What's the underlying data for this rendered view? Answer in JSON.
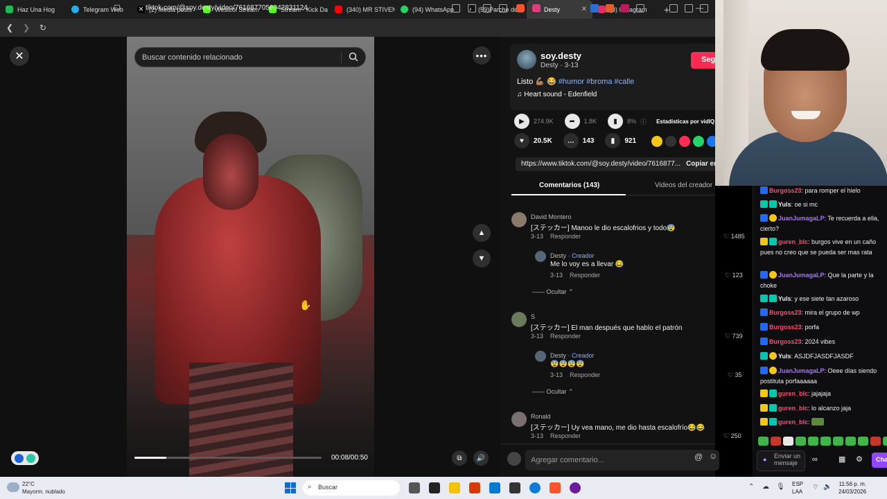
{
  "browser": {
    "tabs": [
      {
        "label": "Haz Una Hog",
        "color": "#1db954"
      },
      {
        "label": "Telegram Web",
        "color": "#2aabee"
      },
      {
        "label": "(2) Media posts",
        "color": "#000000"
      },
      {
        "label": "Westcol Stream",
        "color": "#53fc18"
      },
      {
        "label": "Stream - Kick Da",
        "color": "#53fc18"
      },
      {
        "label": "(340) MR STIVEN",
        "color": "#ff0000"
      },
      {
        "label": "(94) WhatsApp",
        "color": "#25d366"
      },
      {
        "label": "(59)Parche del d",
        "color": "#111111"
      },
      {
        "label": "Desty",
        "color": "#111111"
      },
      {
        "label": "(8) Instagram",
        "color": "#e1306c"
      }
    ],
    "url": "tiktok.com/@soy.desty/video/7616877056042831124"
  },
  "video": {
    "search_placeholder": "Buscar contenido relacionado",
    "time": "00:08/00:50",
    "progress_fraction": 0.17
  },
  "post": {
    "username": "soy.desty",
    "display_sub": "Desty · 3-13",
    "follow_label": "Seg",
    "caption_prefix": "Listo 💪🏽 😂",
    "hashtags": "#humor #broma #calle",
    "music": "Heart sound - Edenfield",
    "plays": "274.9K",
    "shares_small": "1.8K",
    "stats_pct": "8%",
    "stats_label": "Estadísticas por vidIQ",
    "likes": "20.5K",
    "comments_count": "143",
    "saves": "921",
    "link": "https://www.tiktok.com/@soy.desty/video/7616877...",
    "copy_label": "Copiar en",
    "tab_comments": "Comentarios (143)",
    "tab_videos": "Videos del creador"
  },
  "comments": [
    {
      "name": "David Montero",
      "text": "[ステッカー] Manoo le dio escalofrios y todo😰",
      "date": "3-13",
      "reply": "Responder",
      "likes": "1485"
    },
    {
      "name": "Desty",
      "creator": "· Creador",
      "text": "Me lo voy es a llevar 😂",
      "date": "3-13",
      "reply": "Responder",
      "likes": "123"
    },
    {
      "name": "S",
      "text": "[ステッカー] El man después que hablo el patrón",
      "date": "3-13",
      "reply": "Responder",
      "likes": "739"
    },
    {
      "name": "Desty",
      "creator": "· Creador",
      "text": "😨😨😨😨",
      "date": "3-13",
      "reply": "Responder",
      "likes": "35"
    },
    {
      "name": "Ronald",
      "text": "[ステッカー] Uy vea mano, me dio hasta escalofrío😂😂",
      "date": "3-13",
      "reply": "Responder",
      "likes": "250"
    }
  ],
  "hide_label": "Ocultar",
  "add_comment_placeholder": "Agregar comentario...",
  "chat": [
    {
      "user": "Burgoss23",
      "color": "#ff4b6e",
      "text": ": para romper el hielo"
    },
    {
      "user": "Yuls",
      "color": "#efeff1",
      "text": ": oe si mc"
    },
    {
      "user": "JuanJumagaLP",
      "color": "#a970ff",
      "text": ": Te recuerda a ella, cierto?"
    },
    {
      "user": "guren_blc",
      "color": "#ff4b6e",
      "text": ": burgos vive en un caño pues no creo que se pueda ser mas rata"
    },
    {
      "user": "JuanJumagaLP",
      "color": "#a970ff",
      "text": ": Que la parte y la choke"
    },
    {
      "user": "Yuls",
      "color": "#efeff1",
      "text": ": y ese siete tan azaroso"
    },
    {
      "user": "Burgoss23",
      "color": "#ff4b6e",
      "text": ": mira el grupo de wp"
    },
    {
      "user": "Burgoss23",
      "color": "#ff4b6e",
      "text": ": porfa"
    },
    {
      "user": "Burgoss23",
      "color": "#ff4b6e",
      "text": ": 2024 vibes"
    },
    {
      "user": "Yuls",
      "color": "#efeff1",
      "text": ": ASJDFJASDFJASDF"
    },
    {
      "user": "JuanJumagaLP",
      "color": "#a970ff",
      "text": ": Oeee días siendo postituta porfaaaaaa"
    },
    {
      "user": "guren_blc",
      "color": "#ff4b6e",
      "text": ": jajajaja"
    },
    {
      "user": "guren_blc",
      "color": "#ff4b6e",
      "text": ": lo alcanzo jaja"
    },
    {
      "user": "guren_blc",
      "color": "#ff4b6e",
      "text": ":"
    }
  ],
  "chat_input": "Enviar un mensaje",
  "chat_button": "Cha",
  "taskbar": {
    "temp": "22°C",
    "weather": "Mayorm. nublado",
    "search": "Buscar",
    "lang1": "ESP",
    "lang2": "LAA",
    "time": "11:56 p. m.",
    "date": "24/03/2026"
  }
}
